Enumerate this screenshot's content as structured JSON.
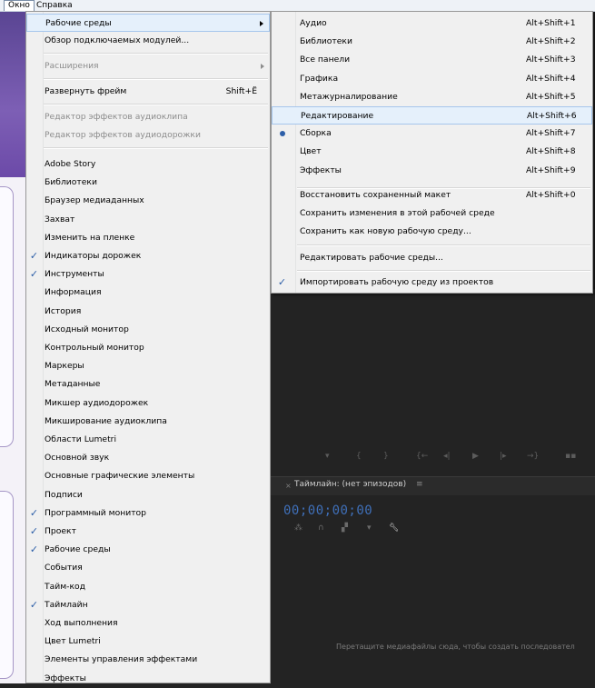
{
  "menubar": {
    "items": [
      "Окно",
      "Справка"
    ]
  },
  "window_menu": {
    "workspaces": "Рабочие среды",
    "plugins_overview": "Обзор подключаемых модулей...",
    "extensions": "Расширения",
    "expand_frame": "Развернуть фрейм",
    "expand_frame_shortcut": "Shift+Ё",
    "clip_fx_editor": "Редактор эффектов аудиоклипа",
    "track_fx_editor": "Редактор эффектов аудиодорожки",
    "panels": [
      {
        "label": "Adobe Story",
        "checked": false
      },
      {
        "label": "Библиотеки",
        "checked": false
      },
      {
        "label": "Браузер медиаданных",
        "checked": false
      },
      {
        "label": "Захват",
        "checked": false
      },
      {
        "label": "Изменить на пленке",
        "checked": false
      },
      {
        "label": "Индикаторы дорожек",
        "checked": true
      },
      {
        "label": "Инструменты",
        "checked": true
      },
      {
        "label": "Информация",
        "checked": false
      },
      {
        "label": "История",
        "checked": false
      },
      {
        "label": "Исходный монитор",
        "checked": false
      },
      {
        "label": "Контрольный монитор",
        "checked": false
      },
      {
        "label": "Маркеры",
        "checked": false
      },
      {
        "label": "Метаданные",
        "checked": false
      },
      {
        "label": "Микшер аудиодорожек",
        "checked": false
      },
      {
        "label": "Микширование аудиоклипа",
        "checked": false
      },
      {
        "label": "Области Lumetri",
        "checked": false
      },
      {
        "label": "Основной звук",
        "checked": false
      },
      {
        "label": "Основные графические элементы",
        "checked": false
      },
      {
        "label": "Подписи",
        "checked": false
      },
      {
        "label": "Программный монитор",
        "checked": true
      },
      {
        "label": "Проект",
        "checked": true
      },
      {
        "label": "Рабочие среды",
        "checked": true
      },
      {
        "label": "События",
        "checked": false
      },
      {
        "label": "Тайм-код",
        "checked": false
      },
      {
        "label": "Таймлайн",
        "checked": true
      },
      {
        "label": "Ход выполнения",
        "checked": false
      },
      {
        "label": "Цвет Lumetri",
        "checked": false
      },
      {
        "label": "Элементы управления эффектами",
        "checked": false
      },
      {
        "label": "Эффекты",
        "checked": false
      }
    ]
  },
  "workspaces_menu": {
    "items": [
      {
        "label": "Аудио",
        "shortcut": "Alt+Shift+1"
      },
      {
        "label": "Библиотеки",
        "shortcut": "Alt+Shift+2"
      },
      {
        "label": "Все панели",
        "shortcut": "Alt+Shift+3"
      },
      {
        "label": "Графика",
        "shortcut": "Alt+Shift+4"
      },
      {
        "label": "Метажурналирование",
        "shortcut": "Alt+Shift+5"
      },
      {
        "label": "Редактирование",
        "shortcut": "Alt+Shift+6"
      },
      {
        "label": "Сборка",
        "shortcut": "Alt+Shift+7"
      },
      {
        "label": "Цвет",
        "shortcut": "Alt+Shift+8"
      },
      {
        "label": "Эффекты",
        "shortcut": "Alt+Shift+9"
      }
    ],
    "reset_layout": "Восстановить сохраненный макет",
    "reset_shortcut": "Alt+Shift+0",
    "save_changes": "Сохранить изменения в этой рабочей среде",
    "save_new": "Сохранить как новую рабочую среду...",
    "edit_workspaces": "Редактировать рабочие среды...",
    "import_from_projects": "Импортировать рабочую среду из проектов"
  },
  "timeline": {
    "title": "Таймлайн: (нет эпизодов)",
    "timecode": "00;00;00;00",
    "drop_hint": "Перетащите медиафайлы сюда, чтобы создать последовател"
  },
  "colors": {
    "check": "#2d5fa8",
    "timecode": "#3f6fb8",
    "highlight": "#e5f0fb"
  }
}
